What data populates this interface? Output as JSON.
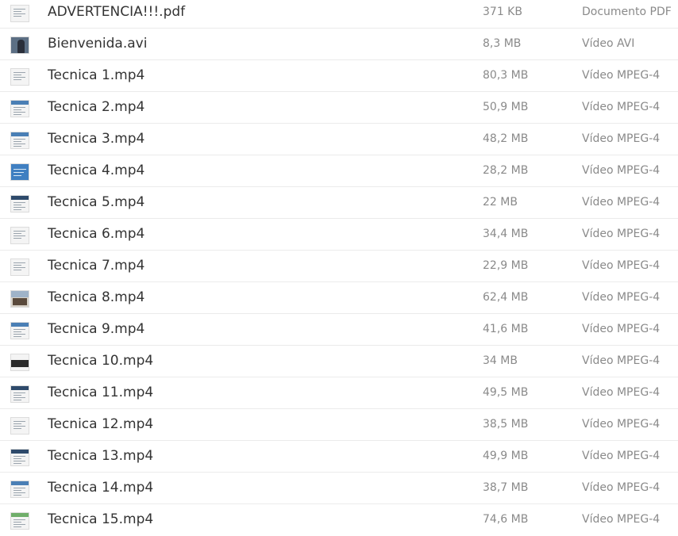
{
  "files": [
    {
      "name": "ADVERTENCIA!!!.pdf",
      "size": "371 KB",
      "type": "Documento PDF",
      "thumb": "document-thumbnail-icon",
      "style": "doc"
    },
    {
      "name": "Bienvenida.avi",
      "size": "8,3 MB",
      "type": "Vídeo AVI",
      "thumb": "video-thumbnail-icon",
      "style": "photo"
    },
    {
      "name": "Tecnica 1.mp4",
      "size": "80,3 MB",
      "type": "Vídeo MPEG-4",
      "thumb": "video-thumbnail-icon",
      "style": "doc"
    },
    {
      "name": "Tecnica 2.mp4",
      "size": "50,9 MB",
      "type": "Vídeo MPEG-4",
      "thumb": "video-thumbnail-icon",
      "style": "doc-blue"
    },
    {
      "name": "Tecnica 3.mp4",
      "size": "48,2 MB",
      "type": "Vídeo MPEG-4",
      "thumb": "video-thumbnail-icon",
      "style": "doc-blue"
    },
    {
      "name": "Tecnica 4.mp4",
      "size": "28,2 MB",
      "type": "Vídeo MPEG-4",
      "thumb": "video-thumbnail-icon",
      "style": "blue"
    },
    {
      "name": "Tecnica 5.mp4",
      "size": "22 MB",
      "type": "Vídeo MPEG-4",
      "thumb": "video-thumbnail-icon",
      "style": "doc-navy"
    },
    {
      "name": "Tecnica 6.mp4",
      "size": "34,4 MB",
      "type": "Vídeo MPEG-4",
      "thumb": "video-thumbnail-icon",
      "style": "doc"
    },
    {
      "name": "Tecnica 7.mp4",
      "size": "22,9 MB",
      "type": "Vídeo MPEG-4",
      "thumb": "video-thumbnail-icon",
      "style": "doc"
    },
    {
      "name": "Tecnica 8.mp4",
      "size": "62,4 MB",
      "type": "Vídeo MPEG-4",
      "thumb": "video-thumbnail-icon",
      "style": "scene"
    },
    {
      "name": "Tecnica 9.mp4",
      "size": "41,6 MB",
      "type": "Vídeo MPEG-4",
      "thumb": "video-thumbnail-icon",
      "style": "doc-blue"
    },
    {
      "name": "Tecnica 10.mp4",
      "size": "34 MB",
      "type": "Vídeo MPEG-4",
      "thumb": "video-thumbnail-icon",
      "style": "dark"
    },
    {
      "name": "Tecnica 11.mp4",
      "size": "49,5 MB",
      "type": "Vídeo MPEG-4",
      "thumb": "video-thumbnail-icon",
      "style": "doc-navy"
    },
    {
      "name": "Tecnica 12.mp4",
      "size": "38,5 MB",
      "type": "Vídeo MPEG-4",
      "thumb": "video-thumbnail-icon",
      "style": "doc"
    },
    {
      "name": "Tecnica 13.mp4",
      "size": "49,9 MB",
      "type": "Vídeo MPEG-4",
      "thumb": "video-thumbnail-icon",
      "style": "doc-navy"
    },
    {
      "name": "Tecnica 14.mp4",
      "size": "38,7 MB",
      "type": "Vídeo MPEG-4",
      "thumb": "video-thumbnail-icon",
      "style": "doc-blue"
    },
    {
      "name": "Tecnica 15.mp4",
      "size": "74,6 MB",
      "type": "Vídeo MPEG-4",
      "thumb": "video-thumbnail-icon",
      "style": "doc-green"
    }
  ],
  "colors": {
    "name_text": "#333333",
    "meta_text": "#8a8a8a",
    "row_divider": "#ebebeb"
  }
}
